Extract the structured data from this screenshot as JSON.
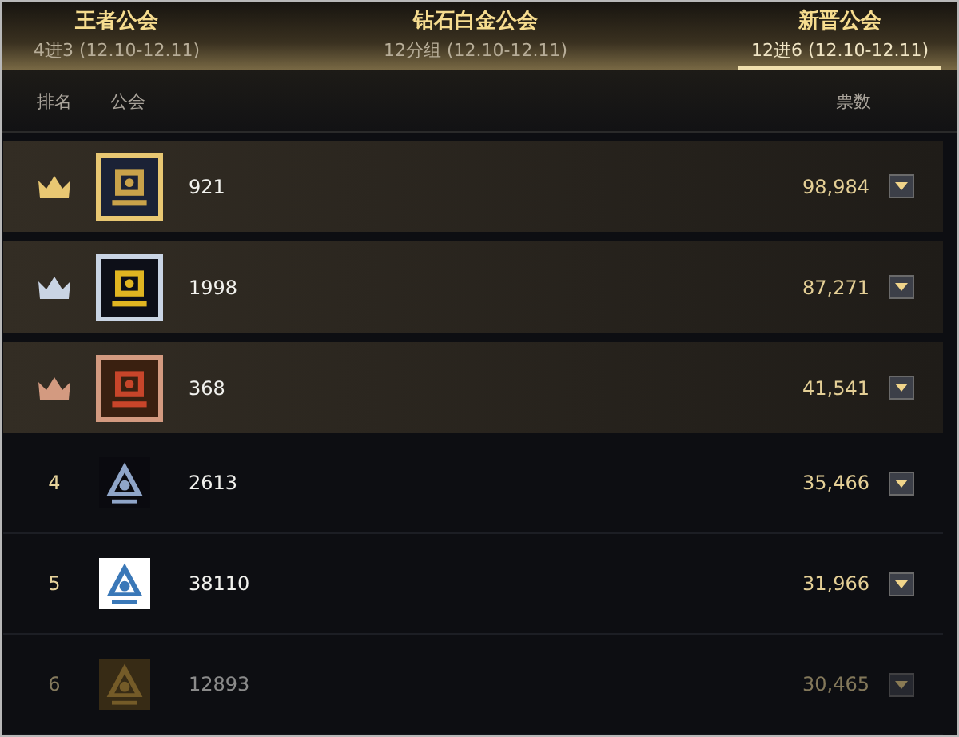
{
  "tabs": [
    {
      "title": "王者公会",
      "subtitle": "4进3 (12.10-12.11)",
      "selected": false
    },
    {
      "title": "钻石白金公会",
      "subtitle": "12分组 (12.10-12.11)",
      "selected": false
    },
    {
      "title": "新晋公会",
      "subtitle": "12进6 (12.10-12.11)",
      "selected": true
    }
  ],
  "columns": {
    "rank": "排名",
    "guild": "公会",
    "votes": "票数"
  },
  "rows": [
    {
      "kind": "crown",
      "color": "#e8c772",
      "name": "921",
      "votes": "98,984"
    },
    {
      "kind": "crown",
      "color": "#c9d4e4",
      "name": "1998",
      "votes": "87,271"
    },
    {
      "kind": "crown",
      "color": "#d39a80",
      "name": "368",
      "votes": "41,541"
    },
    {
      "kind": "number",
      "rank": "4",
      "name": "2613",
      "votes": "35,466",
      "dimmed": false
    },
    {
      "kind": "number",
      "rank": "5",
      "name": "38110",
      "votes": "31,966",
      "dimmed": false
    },
    {
      "kind": "number",
      "rank": "6",
      "name": "12893",
      "votes": "30,465",
      "dimmed": true
    }
  ]
}
